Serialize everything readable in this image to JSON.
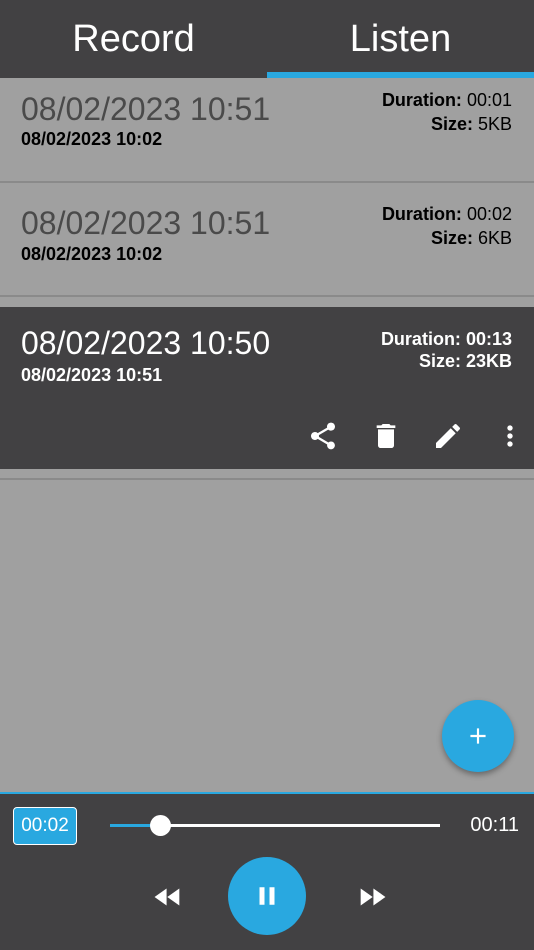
{
  "tabs": [
    {
      "label": "Record"
    },
    {
      "label": "Listen"
    }
  ],
  "recordings": [
    {
      "title": "08/02/2023 10:51",
      "subtitle": "08/02/2023 10:02",
      "duration_label": "Duration:",
      "duration": "00:01",
      "size_label": "Size:",
      "size": "5KB"
    },
    {
      "title": "08/02/2023 10:51",
      "subtitle": "08/02/2023 10:02",
      "duration_label": "Duration:",
      "duration": "00:02",
      "size_label": "Size:",
      "size": "6KB"
    },
    {
      "title": "08/02/2023 10:50",
      "subtitle": "08/02/2023 10:51",
      "duration_label": "Duration:",
      "duration": "00:13",
      "size_label": "Size:",
      "size": "23KB",
      "selected": true
    }
  ],
  "actions": {
    "icons": [
      "share-icon",
      "delete-icon",
      "edit-icon",
      "more-vert-icon"
    ]
  },
  "fab": {
    "icon": "plus-icon"
  },
  "player": {
    "current_time": "00:02",
    "total_time": "00:11",
    "progress": 0.15,
    "state": "playing"
  },
  "colors": {
    "accent": "#29a8e0",
    "bar": "#424143",
    "background": "#a0a0a0"
  }
}
